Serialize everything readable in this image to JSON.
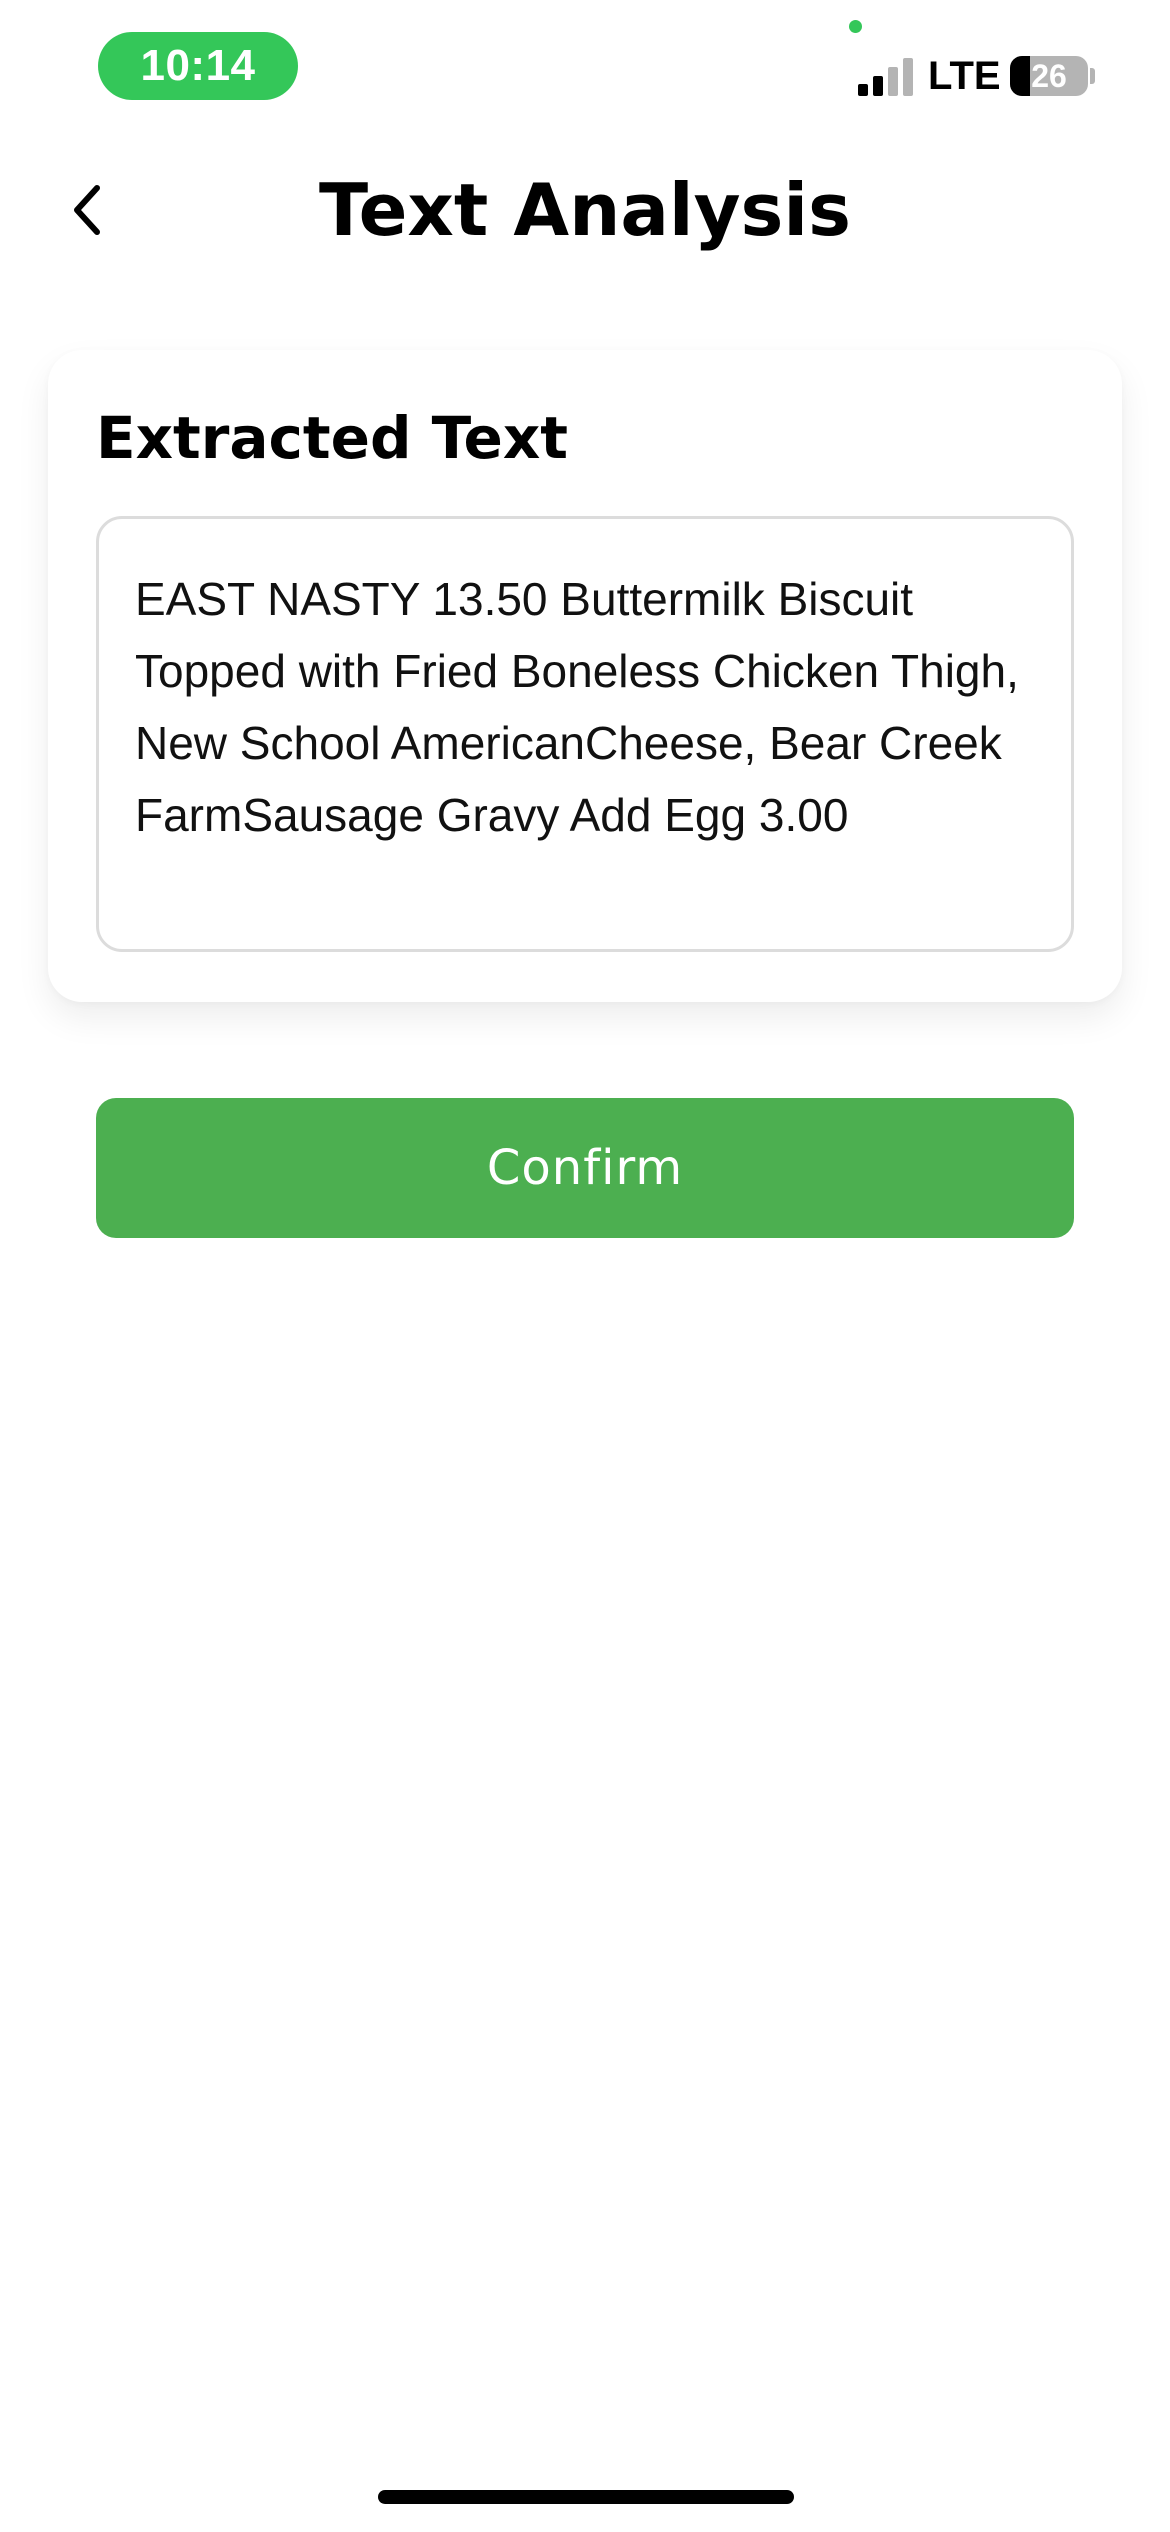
{
  "status_bar": {
    "time": "10:14",
    "network": "LTE",
    "battery_percent": "26",
    "battery_level": 0.26,
    "signal_bars_active": 2,
    "signal_bars_total": 4,
    "accent_color": "#34c759"
  },
  "header": {
    "back_icon": "chevron-left-icon",
    "title": "Text Analysis"
  },
  "card": {
    "heading": "Extracted Text",
    "extracted_text": "EAST NASTY 13.50 Buttermilk Biscuit Topped with Fried Boneless Chicken Thigh, New School AmericanCheese, Bear Creek FarmSausage Gravy Add Egg 3.00"
  },
  "actions": {
    "confirm_label": "Confirm",
    "confirm_color": "#4caf50"
  }
}
